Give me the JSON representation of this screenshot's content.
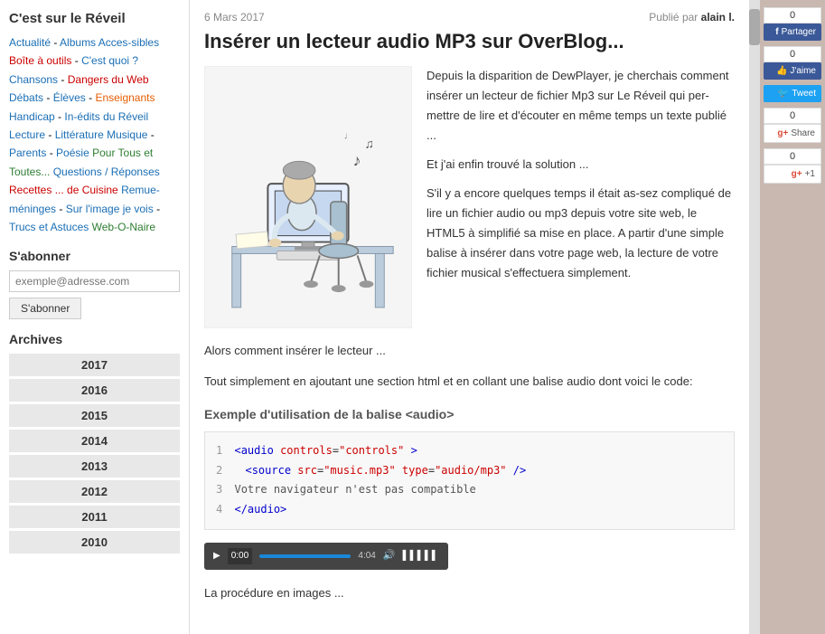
{
  "site": {
    "title": "C'est sur le Réveil"
  },
  "nav": {
    "items": [
      {
        "label": "Actualité",
        "color": "blue"
      },
      {
        "label": " -",
        "color": "default"
      },
      {
        "label": "Albums Acces-sibles",
        "color": "blue"
      },
      {
        "label": " ",
        "color": "default"
      },
      {
        "label": "Boîte à outils",
        "color": "red"
      },
      {
        "label": " - ",
        "color": "default"
      },
      {
        "label": "C'est quoi ?",
        "color": "blue"
      },
      {
        "label": " ",
        "color": "default"
      },
      {
        "label": "Chansons",
        "color": "blue"
      },
      {
        "label": " - ",
        "color": "default"
      },
      {
        "label": "Dangers du Web",
        "color": "red"
      },
      {
        "label": " ",
        "color": "default"
      },
      {
        "label": "Débats",
        "color": "blue"
      },
      {
        "label": " - ",
        "color": "default"
      },
      {
        "label": "Élèves",
        "color": "blue"
      },
      {
        "label": " - ",
        "color": "default"
      },
      {
        "label": "Enseignants",
        "color": "orange"
      },
      {
        "label": " ",
        "color": "default"
      },
      {
        "label": "Handicap",
        "color": "blue"
      },
      {
        "label": " - ",
        "color": "default"
      },
      {
        "label": "In-édits du Réveil",
        "color": "blue"
      },
      {
        "label": " ",
        "color": "default"
      },
      {
        "label": "Lecture",
        "color": "blue"
      },
      {
        "label": " - ",
        "color": "default"
      },
      {
        "label": "Littérature",
        "color": "blue"
      },
      {
        "label": "       ",
        "color": "default"
      },
      {
        "label": "Musique",
        "color": "blue"
      },
      {
        "label": " - ",
        "color": "default"
      },
      {
        "label": "Parents",
        "color": "blue"
      },
      {
        "label": " - ",
        "color": "default"
      },
      {
        "label": "Poésie",
        "color": "blue"
      },
      {
        "label": "   ",
        "color": "default"
      },
      {
        "label": "Pour Tous et Toutes...",
        "color": "green"
      },
      {
        "label": " ",
        "color": "default"
      },
      {
        "label": "Questions / Réponses",
        "color": "blue"
      },
      {
        "label": "    ",
        "color": "default"
      },
      {
        "label": "Recettes ... de Cuisine",
        "color": "red"
      },
      {
        "label": " ",
        "color": "default"
      },
      {
        "label": "Remue-méninges",
        "color": "blue"
      },
      {
        "label": " - ",
        "color": "default"
      },
      {
        "label": "Sur l'image je vois",
        "color": "blue"
      },
      {
        "label": " - ",
        "color": "default"
      },
      {
        "label": "Trucs et Astuces",
        "color": "blue"
      },
      {
        "label": " ",
        "color": "default"
      },
      {
        "label": "Web-O-Naire",
        "color": "green"
      }
    ]
  },
  "subscribe": {
    "heading": "S'abonner",
    "placeholder": "exemple@adresse.com",
    "button_label": "S'abonner"
  },
  "archives": {
    "heading": "Archives",
    "years": [
      "2017",
      "2016",
      "2015",
      "2014",
      "2013",
      "2012",
      "2011",
      "2010"
    ]
  },
  "post": {
    "date": "6 Mars 2017",
    "published_by_label": "Publié par",
    "author": "alain l.",
    "title": "Insérer un lecteur audio MP3 sur OverBlog...",
    "intro_p1": "Depuis la disparition de DewPlayer, je cherchais  comment insérer un lecteur de fichier Mp3 sur Le Réveil qui per-mettre de lire et d'écouter en même temps un texte publié ...",
    "intro_p2": "Et j'ai enfin trouvé la solution ...",
    "body_p1": "S'il y a encore quelques temps il était as-sez compliqué de lire un fichier audio ou mp3 depuis votre site web, le HTML5 à simplifié sa mise en place.  A partir d'une simple balise à insérer dans votre page web, la lecture de votre fichier musical s'effectuera simplement.",
    "section_text": "Alors comment insérer le lecteur ...",
    "section_text2": "Tout simplement en ajoutant une section html et en collant une balise audio dont voici le code:",
    "example_heading": "Exemple d'utilisation de la balise <audio>",
    "code": {
      "line1": "<audio controls=\"controls\">",
      "line2": "  <source src=\"music.mp3\" type=\"audio/mp3\" />",
      "line3": "  Votre navigateur n'est pas compatible",
      "line4": "</audio>"
    },
    "audio_time": "0:00",
    "audio_duration": "4:04",
    "footer_text": "La procédure en images ..."
  },
  "social": {
    "fb_count": "0",
    "fb_share_label": "Partager",
    "fb_like_count": "0",
    "fb_like_label": "J'aime",
    "tw_label": "Tweet",
    "gp_count": "0",
    "gp_share_label": "Share",
    "gp_plus_count": "0",
    "gp_plus_label": "+1"
  }
}
